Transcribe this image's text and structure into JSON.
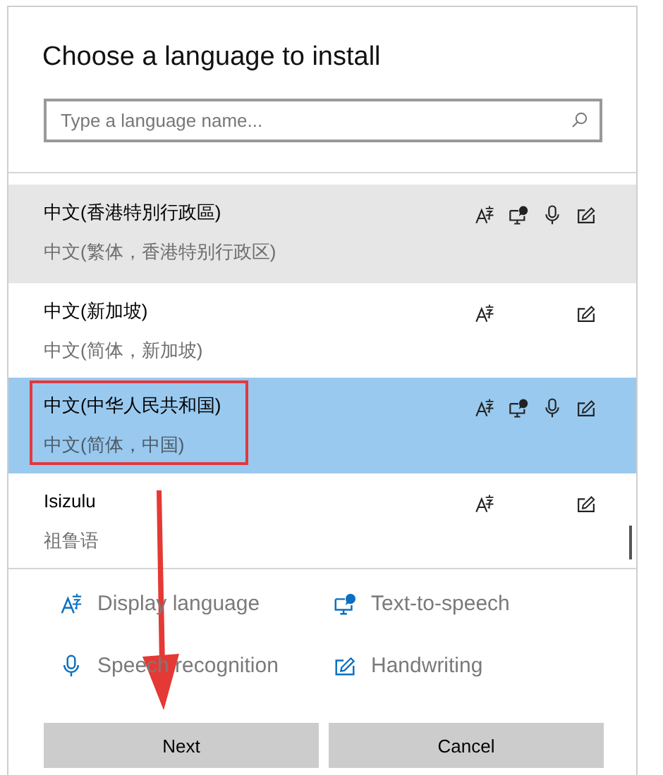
{
  "dialog": {
    "title": "Choose a language to install"
  },
  "search": {
    "placeholder": "Type a language name..."
  },
  "languages": [
    {
      "name": "中文(香港特別行政區)",
      "native": "中文(繁体，香港特别行政区)",
      "hovered": true,
      "selected": false,
      "highlighted": false,
      "features": {
        "display": true,
        "tts": true,
        "speech": true,
        "handwriting": true
      }
    },
    {
      "name": "中文(新加坡)",
      "native": "中文(简体，新加坡)",
      "hovered": false,
      "selected": false,
      "highlighted": false,
      "features": {
        "display": true,
        "tts": false,
        "speech": false,
        "handwriting": true
      }
    },
    {
      "name": "中文(中华人民共和国)",
      "native": "中文(简体，中国)",
      "hovered": false,
      "selected": true,
      "highlighted": true,
      "features": {
        "display": true,
        "tts": true,
        "speech": true,
        "handwriting": true
      }
    },
    {
      "name": "Isizulu",
      "native": "祖鲁语",
      "hovered": false,
      "selected": false,
      "highlighted": false,
      "features": {
        "display": true,
        "tts": false,
        "speech": false,
        "handwriting": true
      }
    }
  ],
  "legend": [
    {
      "kind": "display",
      "label": "Display language"
    },
    {
      "kind": "tts",
      "label": "Text-to-speech"
    },
    {
      "kind": "speech",
      "label": "Speech recognition"
    },
    {
      "kind": "handwriting",
      "label": "Handwriting"
    }
  ],
  "buttons": [
    "Next",
    "Cancel"
  ],
  "arrow_to_next": true
}
